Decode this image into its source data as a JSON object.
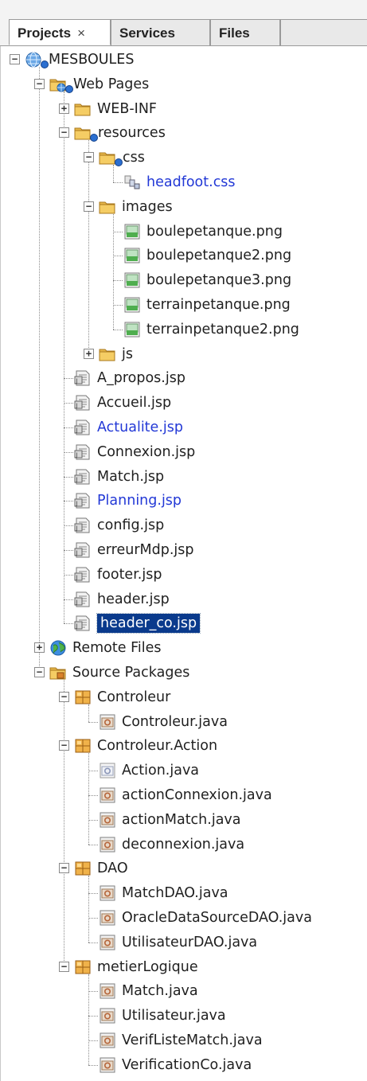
{
  "tabs": [
    {
      "label": "Projects",
      "close": "×",
      "active": true
    },
    {
      "label": "Services",
      "active": false
    },
    {
      "label": "Files",
      "active": false
    }
  ],
  "colors": {
    "modified_text": "#2238d6",
    "selected_bg": "#0a3a8c",
    "folder": "#e8b84a",
    "package": "#e0a040"
  },
  "tree": [
    {
      "label": "MESBOULES",
      "icon": "project-globe-icon",
      "depth": 0,
      "expander": "minus",
      "badge": true
    },
    {
      "label": "Web Pages",
      "icon": "web-pages-folder-icon",
      "depth": 1,
      "expander": "minus",
      "badge": true
    },
    {
      "label": "WEB-INF",
      "icon": "folder-icon",
      "depth": 2,
      "expander": "plus"
    },
    {
      "label": "resources",
      "icon": "folder-icon",
      "depth": 2,
      "expander": "minus",
      "badge": true
    },
    {
      "label": "css",
      "icon": "folder-icon",
      "depth": 3,
      "expander": "minus",
      "badge": true
    },
    {
      "label": "headfoot.css",
      "icon": "css-file-icon",
      "depth": 4,
      "state": "modified"
    },
    {
      "label": "images",
      "icon": "folder-icon",
      "depth": 3,
      "expander": "minus"
    },
    {
      "label": "boulepetanque.png",
      "icon": "image-file-icon",
      "depth": 4
    },
    {
      "label": "boulepetanque2.png",
      "icon": "image-file-icon",
      "depth": 4
    },
    {
      "label": "boulepetanque3.png",
      "icon": "image-file-icon",
      "depth": 4
    },
    {
      "label": "terrainpetanque.png",
      "icon": "image-file-icon",
      "depth": 4
    },
    {
      "label": "terrainpetanque2.png",
      "icon": "image-file-icon",
      "depth": 4
    },
    {
      "label": "js",
      "icon": "folder-icon",
      "depth": 3,
      "expander": "plus"
    },
    {
      "label": "A_propos.jsp",
      "icon": "jsp-file-icon",
      "depth": 2
    },
    {
      "label": "Accueil.jsp",
      "icon": "jsp-file-icon",
      "depth": 2
    },
    {
      "label": "Actualite.jsp",
      "icon": "jsp-file-icon",
      "depth": 2,
      "state": "modified"
    },
    {
      "label": "Connexion.jsp",
      "icon": "jsp-file-icon",
      "depth": 2
    },
    {
      "label": "Match.jsp",
      "icon": "jsp-file-icon",
      "depth": 2
    },
    {
      "label": "Planning.jsp",
      "icon": "jsp-file-icon",
      "depth": 2,
      "state": "modified"
    },
    {
      "label": "config.jsp",
      "icon": "jsp-file-icon",
      "depth": 2
    },
    {
      "label": "erreurMdp.jsp",
      "icon": "jsp-file-icon",
      "depth": 2
    },
    {
      "label": "footer.jsp",
      "icon": "jsp-file-icon",
      "depth": 2
    },
    {
      "label": "header.jsp",
      "icon": "jsp-file-icon",
      "depth": 2
    },
    {
      "label": "header_co.jsp",
      "icon": "jsp-file-icon",
      "depth": 2,
      "state": "selected"
    },
    {
      "label": "Remote Files",
      "icon": "remote-files-globe-icon",
      "depth": 1,
      "expander": "plus"
    },
    {
      "label": "Source Packages",
      "icon": "source-packages-folder-icon",
      "depth": 1,
      "expander": "minus"
    },
    {
      "label": "Controleur",
      "icon": "package-icon",
      "depth": 2,
      "expander": "minus"
    },
    {
      "label": "Controleur.java",
      "icon": "java-class-icon",
      "depth": 3
    },
    {
      "label": "Controleur.Action",
      "icon": "package-icon",
      "depth": 2,
      "expander": "minus"
    },
    {
      "label": "Action.java",
      "icon": "java-interface-icon",
      "depth": 3
    },
    {
      "label": "actionConnexion.java",
      "icon": "java-class-icon",
      "depth": 3
    },
    {
      "label": "actionMatch.java",
      "icon": "java-class-icon",
      "depth": 3
    },
    {
      "label": "deconnexion.java",
      "icon": "java-class-icon",
      "depth": 3
    },
    {
      "label": "DAO",
      "icon": "package-icon",
      "depth": 2,
      "expander": "minus"
    },
    {
      "label": "MatchDAO.java",
      "icon": "java-class-icon",
      "depth": 3
    },
    {
      "label": "OracleDataSourceDAO.java",
      "icon": "java-class-icon",
      "depth": 3
    },
    {
      "label": "UtilisateurDAO.java",
      "icon": "java-class-icon",
      "depth": 3
    },
    {
      "label": "metierLogique",
      "icon": "package-icon",
      "depth": 2,
      "expander": "minus"
    },
    {
      "label": "Match.java",
      "icon": "java-class-icon",
      "depth": 3
    },
    {
      "label": "Utilisateur.java",
      "icon": "java-class-icon",
      "depth": 3
    },
    {
      "label": "VerifListeMatch.java",
      "icon": "java-class-icon",
      "depth": 3
    },
    {
      "label": "VerificationCo.java",
      "icon": "java-class-icon",
      "depth": 3
    }
  ]
}
